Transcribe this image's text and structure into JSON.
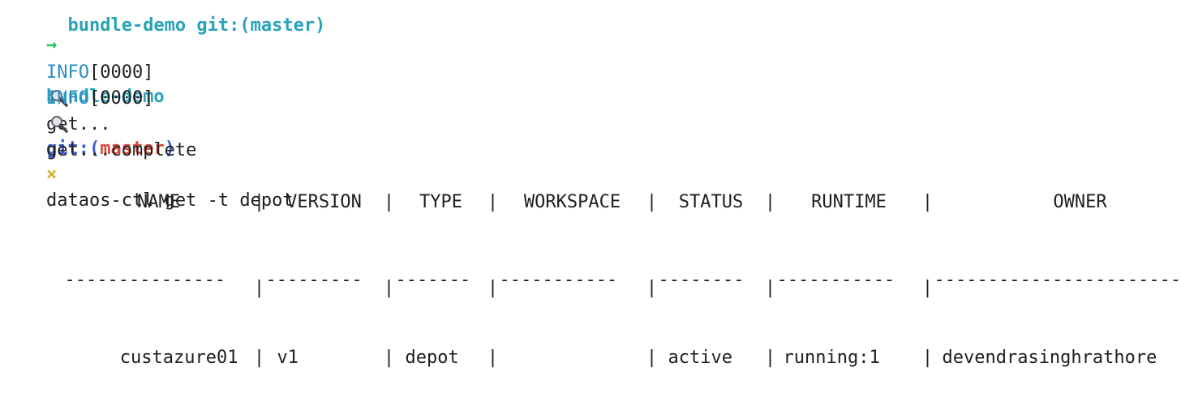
{
  "terminal": {
    "clipped_previous_line": "  bundle-demo git:(master)",
    "prompt": {
      "arrow": "→",
      "directory": "bundle-demo",
      "git_prefix": "git:(",
      "branch": "master",
      "git_suffix": ")",
      "dirty_marker": "×",
      "command": "dataos-ctl get -t depot"
    },
    "log_lines": [
      {
        "level": "INFO",
        "code": "[0000]",
        "icon": "magnifier-icon",
        "text": "get..."
      },
      {
        "level": "INFO",
        "code": "[0000]",
        "icon": "magnifier-icon",
        "text": "get...complete"
      }
    ],
    "table": {
      "headers": [
        "NAME",
        "VERSION",
        "TYPE",
        "WORKSPACE",
        "STATUS",
        "RUNTIME",
        "OWNER"
      ],
      "separator": [
        "---------------",
        "---------",
        "-------",
        "-----------",
        "--------",
        "-----------",
        "-----------------------"
      ],
      "rows": [
        [
          "custazure01",
          "v1",
          "depot",
          "",
          "active",
          "running:1",
          "devendrasinghrathore"
        ]
      ]
    }
  }
}
